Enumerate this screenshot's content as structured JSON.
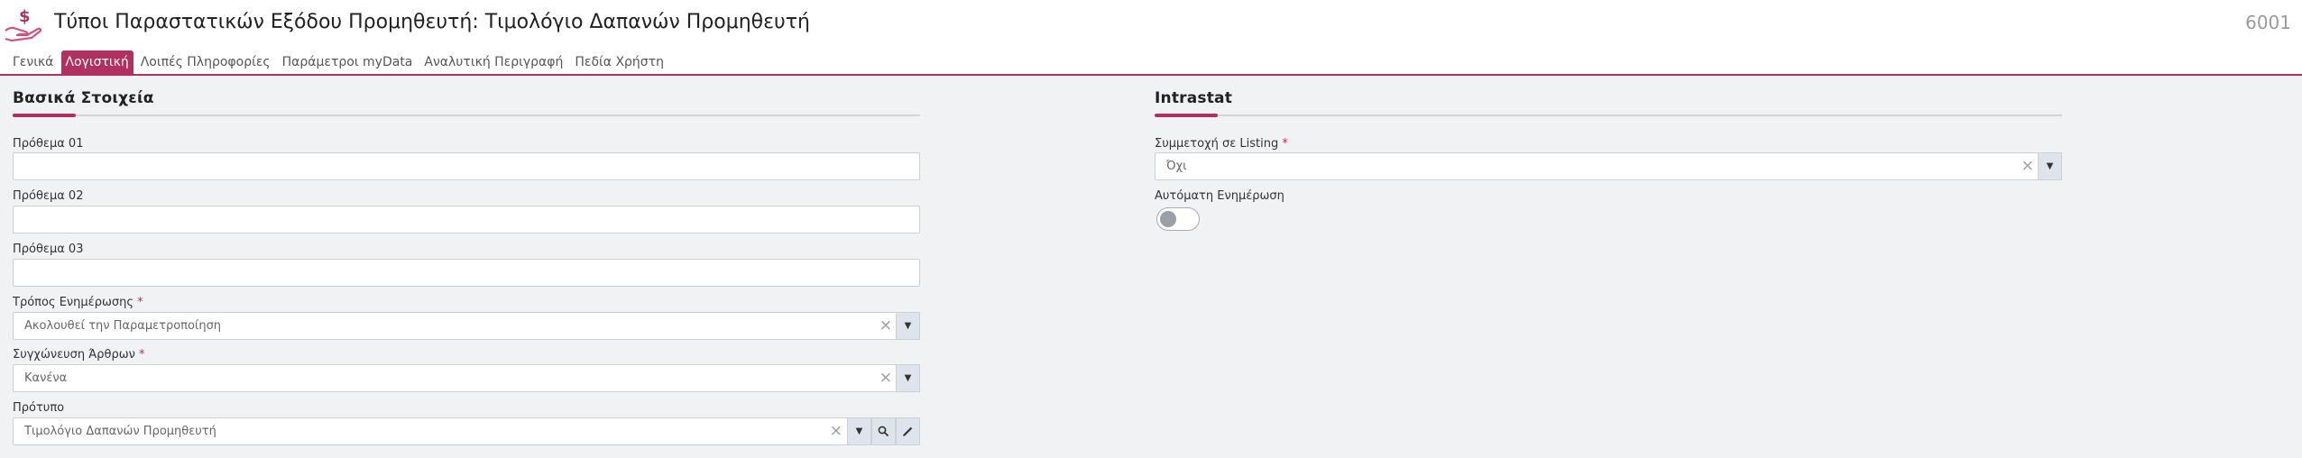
{
  "header": {
    "title": "Τύποι Παραστατικών Εξόδου Προμηθευτή: Τιμολόγιο Δαπανών Προμηθευτή",
    "record_number": "6001",
    "icon": "hand-money-icon"
  },
  "tabs": [
    {
      "label": "Γενικά",
      "active": false
    },
    {
      "label": "Λογιστική",
      "active": true
    },
    {
      "label": "Λοιπές Πληροφορίες",
      "active": false
    },
    {
      "label": "Παράμετροι myData",
      "active": false
    },
    {
      "label": "Αναλυτική Περιγραφή",
      "active": false
    },
    {
      "label": "Πεδία Χρήστη",
      "active": false
    }
  ],
  "basic": {
    "title": "Βασικά Στοιχεία",
    "prefix1": {
      "label": "Πρόθεμα 01",
      "value": ""
    },
    "prefix2": {
      "label": "Πρόθεμα 02",
      "value": ""
    },
    "prefix3": {
      "label": "Πρόθεμα 03",
      "value": ""
    },
    "update_mode": {
      "label": "Τρόπος Ενημέρωσης",
      "required": "*",
      "value": "Ακολουθεί την Παραμετροποίηση"
    },
    "merge_items": {
      "label": "Συγχώνευση Άρθρων",
      "required": "*",
      "value": "Κανένα"
    },
    "template": {
      "label": "Πρότυπο",
      "value": "Τιμολόγιο Δαπανών Προμηθευτή"
    }
  },
  "intrastat": {
    "title": "Intrastat",
    "listing": {
      "label": "Συμμετοχή σε Listing",
      "required": "*",
      "value": "Όχι"
    },
    "auto_update": {
      "label": "Αυτόματη Ενημέρωση",
      "on": false
    }
  },
  "colors": {
    "accent": "#b0305f"
  }
}
